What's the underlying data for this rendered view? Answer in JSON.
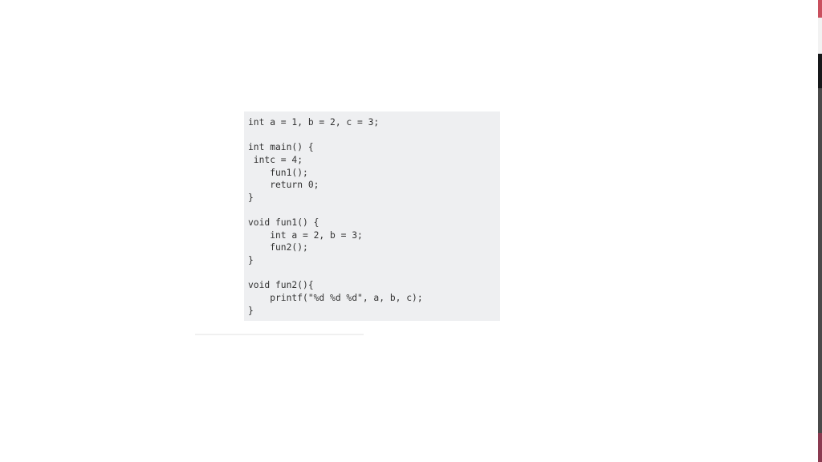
{
  "code_snippet": {
    "lines": [
      "int a = 1, b = 2, c = 3;",
      "",
      "int main() {",
      " intc = 4;",
      "    fun1();",
      "    return 0;",
      "}",
      "",
      "void fun1() {",
      "    int a = 2, b = 3;",
      "    fun2();",
      "}",
      "",
      "void fun2(){",
      "    printf(\"%d %d %d\", a, b, c);",
      "}"
    ]
  },
  "colors": {
    "code_background": "#eeeff1",
    "code_text": "#333333",
    "strip_red": "#c9505e",
    "strip_black": "#16181a",
    "strip_grey": "#4a4a4a",
    "strip_maroon": "#8a3a50"
  }
}
